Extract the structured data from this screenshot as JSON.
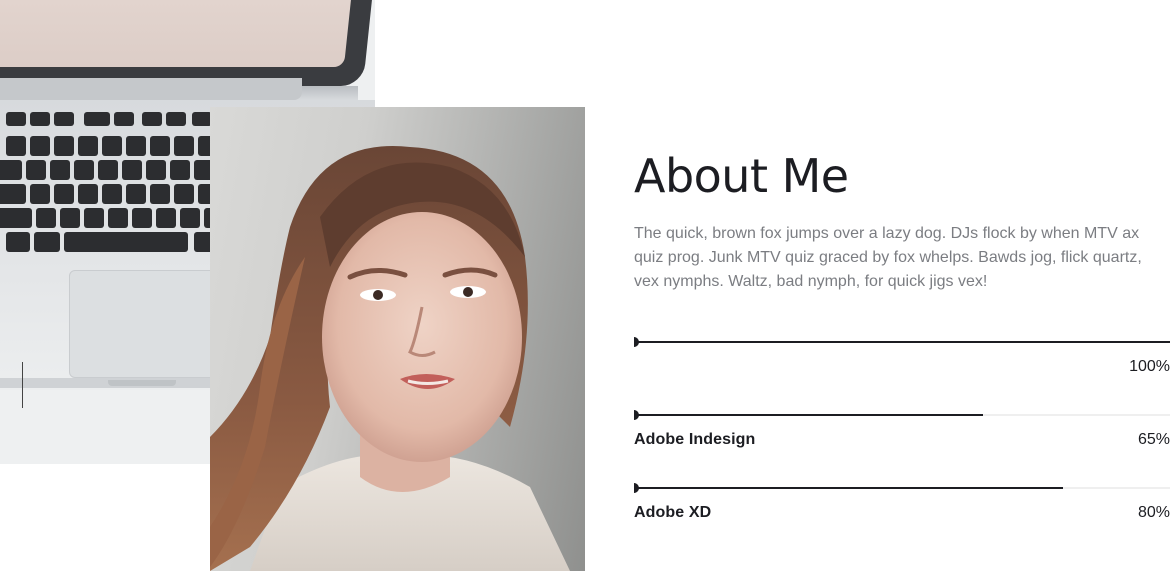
{
  "about": {
    "title": "About Me",
    "description": "The quick, brown fox jumps over a lazy dog. DJs flock by when MTV ax quiz prog. Junk MTV quiz graced by fox whelps. Bawds jog, flick quartz, vex nymphs. Waltz, bad nymph, for quick jigs vex!"
  },
  "skills": [
    {
      "name": "",
      "percent_label": "100%",
      "value": 1.0
    },
    {
      "name": "Adobe Indesign",
      "percent_label": "65%",
      "value": 0.65
    },
    {
      "name": "Adobe XD",
      "percent_label": "80%",
      "value": 0.8
    }
  ],
  "images": {
    "background_photo": "laptop-keyboard-photo",
    "portrait_photo": "woman-portrait-photo"
  },
  "colors": {
    "accent": "#1c1d22",
    "text_muted": "#7b7d82",
    "track": "#efefef"
  }
}
